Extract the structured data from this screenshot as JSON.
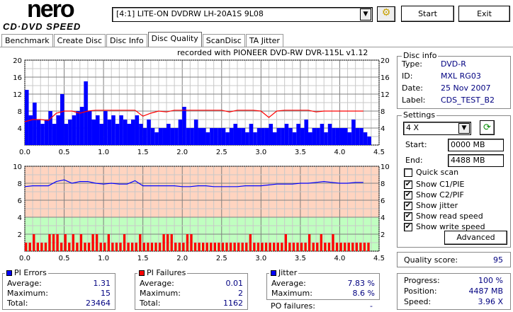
{
  "app": {
    "logo_main": "nero",
    "logo_sub": "CD·DVD SPEED"
  },
  "toolbar": {
    "drive": "[4:1]  LITE-ON DVDRW LH-20A1S 9L08",
    "start": "Start",
    "exit": "Exit"
  },
  "tabs": [
    "Benchmark",
    "Create Disc",
    "Disc Info",
    "Disc Quality",
    "ScanDisc",
    "TA Jitter"
  ],
  "active_tab": "Disc Quality",
  "recorded_with": "recorded with PIONEER DVD-RW  DVR-115L v1.12",
  "disc_info": {
    "title": "Disc info",
    "type_label": "Type:",
    "type": "DVD-R",
    "id_label": "ID:",
    "id": "MXL RG03",
    "date_label": "Date:",
    "date": "25 Nov 2007",
    "label_label": "Label:",
    "label": "CDS_TEST_B2"
  },
  "settings": {
    "title": "Settings",
    "speed": "4 X",
    "start_label": "Start:",
    "start": "0000 MB",
    "end_label": "End:",
    "end": "4488 MB",
    "checkboxes": [
      {
        "label": "Quick scan",
        "checked": false
      },
      {
        "label": "Show C1/PIE",
        "checked": true
      },
      {
        "label": "Show C2/PIF",
        "checked": true
      },
      {
        "label": "Show jitter",
        "checked": true
      },
      {
        "label": "Show read speed",
        "checked": true
      },
      {
        "label": "Show write speed",
        "checked": true
      }
    ],
    "advanced": "Advanced"
  },
  "quality": {
    "label": "Quality score:",
    "value": "95"
  },
  "progress": {
    "progress_label": "Progress:",
    "progress": "100 %",
    "position_label": "Position:",
    "position": "4487 MB",
    "speed_label": "Speed:",
    "speed": "3.96 X"
  },
  "pi_errors": {
    "title": "PI Errors",
    "avg_label": "Average:",
    "avg": "1.31",
    "max_label": "Maximum:",
    "max": "15",
    "total_label": "Total:",
    "total": "23464"
  },
  "pi_failures": {
    "title": "PI Failures",
    "avg_label": "Average:",
    "avg": "0.01",
    "max_label": "Maximum:",
    "max": "2",
    "total_label": "Total:",
    "total": "1162"
  },
  "jitter": {
    "title": "Jitter",
    "avg_label": "Average:",
    "avg": "7.83 %",
    "max_label": "Maximum:",
    "max": "8.6 %",
    "po_label": "PO failures:",
    "po": "-"
  },
  "colors": {
    "pie": "#0000ff",
    "pif": "#ff0000",
    "speed": "#ff0000",
    "jitter": "#0000ff",
    "bad_zone": "#ffd4c0",
    "good_zone": "#c0ffc0"
  },
  "chart_data": [
    {
      "type": "bar",
      "title": "PI Errors / Read speed",
      "xlim": [
        0,
        4.5
      ],
      "ylim": [
        0,
        20
      ],
      "yticks": [
        4,
        8,
        12,
        16,
        20
      ],
      "xticks": [
        "0.0",
        "0.5",
        "1.0",
        "1.5",
        "2.0",
        "2.5",
        "3.0",
        "3.5",
        "4.0",
        "4.5"
      ],
      "x_step": 0.05,
      "pie": [
        13,
        7,
        10,
        6,
        5,
        6,
        8,
        5,
        7,
        12,
        5,
        6,
        7,
        8,
        9,
        15,
        8,
        6,
        7,
        5,
        8,
        6,
        7,
        5,
        7,
        6,
        5,
        6,
        7,
        5,
        4,
        6,
        4,
        3,
        4,
        4,
        5,
        4,
        4,
        6,
        9,
        4,
        4,
        6,
        4,
        4,
        3,
        4,
        4,
        4,
        4,
        3,
        4,
        5,
        4,
        4,
        3,
        5,
        3,
        4,
        4,
        4,
        5,
        3,
        4,
        4,
        5,
        4,
        3,
        5,
        4,
        6,
        3,
        4,
        4,
        5,
        3,
        5,
        4,
        4,
        4,
        4,
        3,
        6,
        4,
        4,
        3,
        2
      ],
      "speed_step": 0.1,
      "speed": [
        5.5,
        6,
        6,
        5.8,
        7.5,
        8,
        8,
        7.5,
        8,
        8.2,
        8.2,
        8.2,
        8.2,
        8.2,
        8.2,
        6.8,
        7.5,
        8,
        7.8,
        8.2,
        8.2,
        8.2,
        8.2,
        8.2,
        8.2,
        8.2,
        7.8,
        8.2,
        8.2,
        8.2,
        8,
        6.5,
        8,
        8.2,
        8.2,
        8.2,
        8.2,
        7.8,
        8,
        8,
        8,
        8,
        8,
        8
      ]
    },
    {
      "type": "line",
      "title": "Jitter / PI Failures",
      "xlim": [
        0,
        4.5
      ],
      "ylim": [
        0,
        10
      ],
      "yticks": [
        2,
        4,
        6,
        8,
        10
      ],
      "xticks": [
        "0.0",
        "0.5",
        "1.0",
        "1.5",
        "2.0",
        "2.5",
        "3.0",
        "3.5",
        "4.0",
        "4.5"
      ],
      "jitter_step": 0.1,
      "jitter": [
        7.6,
        7.7,
        7.7,
        7.7,
        8.2,
        8.4,
        8.0,
        8.2,
        8.2,
        8.0,
        7.9,
        8.0,
        7.9,
        7.9,
        8.3,
        7.7,
        7.7,
        7.7,
        7.7,
        7.7,
        7.6,
        7.6,
        7.7,
        7.7,
        7.6,
        7.6,
        7.6,
        7.6,
        7.7,
        7.7,
        7.7,
        7.8,
        7.9,
        7.9,
        7.9,
        8.0,
        8.0,
        8.1,
        8.2,
        8.1,
        8.0,
        8.0,
        8.1,
        8.1
      ],
      "pif_step": 0.05,
      "pif": [
        1,
        1,
        2,
        1,
        1,
        1,
        2,
        2,
        2,
        1,
        2,
        1,
        2,
        1,
        2,
        1,
        1,
        2,
        2,
        1,
        1,
        2,
        1,
        1,
        1,
        2,
        1,
        1,
        1,
        2,
        1,
        1,
        1,
        1,
        1,
        2,
        2,
        2,
        1,
        1,
        1,
        2,
        2,
        1,
        1,
        1,
        1,
        1,
        1,
        1,
        1,
        1,
        1,
        1,
        1,
        1,
        1,
        2,
        1,
        1,
        1,
        1,
        1,
        1,
        1,
        1,
        2,
        1,
        1,
        1,
        1,
        1,
        2,
        1,
        1,
        2,
        1,
        1,
        2,
        1,
        1,
        1,
        1,
        1,
        1,
        1,
        1,
        1
      ]
    }
  ]
}
